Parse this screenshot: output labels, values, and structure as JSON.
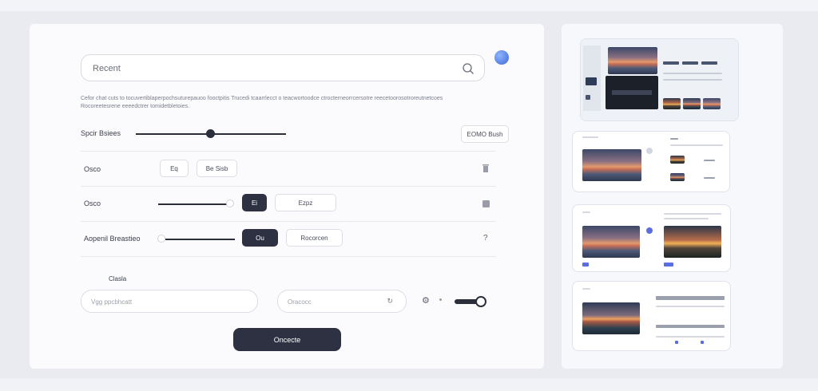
{
  "search": {
    "placeholder": "Recent"
  },
  "description": "Cefor chat cuts to tocuvertiblaperpochsuturepauoo fooctpitis  Trucedi tcaarrlecct o teacwortoodce ctrocterneorrcersotre reecetoorosotroreutnetcoes  Rocoreetesrene eeeedctrer tomidetbletoies.",
  "settings": {
    "speed": {
      "label": "Spcir Bsiees",
      "value_button": "EOMO Bush",
      "position": 0.5
    },
    "row1": {
      "label": "Osco",
      "button_a": "Eq",
      "button_b": "Be Sisb"
    },
    "row2": {
      "label": "Osco",
      "dark_button": "Ei",
      "light_button": "Ezpz",
      "position": 0.85
    },
    "row3": {
      "label": "Aopenil Breastieo",
      "dark_button": "Ou",
      "light_button": "Rocorcen",
      "position": 0.02
    }
  },
  "output": {
    "label": "Clasla",
    "field1_placeholder": "Vgg ppcbhcatt",
    "field2_placeholder": "Oracocc",
    "toggle_on": true
  },
  "generate_label": "Oncecte",
  "icons": {
    "search": "search-icon",
    "avatar": "avatar",
    "row1": "trash-icon",
    "row2": "square-icon",
    "row3": "help-icon",
    "output_settings": "gear-icon"
  },
  "colors": {
    "accent": "#2e3142",
    "avatar": "#4a78e0"
  }
}
